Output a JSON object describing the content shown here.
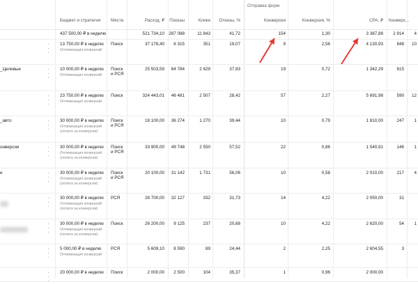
{
  "table": {
    "group_header": "Отправка форм",
    "columns": {
      "budget": "Бюджет и стратегия",
      "places": "Места",
      "spend": "Расход, ₽",
      "impressions": "Показы",
      "clicks": "Клики",
      "bounces": "Отказы, %",
      "conversions": "Конверсии",
      "conv_rate": "Конверсия, %",
      "cpa": "CPA, ₽",
      "conv_extra": "Конверс..."
    },
    "total": {
      "budget": "437 500,00 ₽ в неделю",
      "spend": "521 734,10",
      "impressions": "287 088",
      "clicks": "11 843",
      "bounces": "41,72",
      "conversions": "154",
      "conv_rate": "1,30",
      "cpa": "3 387,88",
      "conv_extra": "2 914",
      "last": "4"
    },
    "rows": [
      {
        "name": "",
        "budget": "13 750,00 ₽ в неделю",
        "strategy": "Оптимизация конверсий",
        "strategy2": "",
        "places": "Поиск",
        "places2": "",
        "spend": "37 178,40",
        "impressions": "6 315",
        "clicks": "351",
        "bounces": "19,07",
        "conversions": "9",
        "conv_rate": "2,56",
        "cpa": "4 130,93",
        "conv_extra": "848",
        "last": "10"
      },
      {
        "name": "_Целевые",
        "budget": "10 000,00 ₽ в неделю",
        "strategy": "Оптимизация конверсий",
        "strategy2": "",
        "places": "Поиск",
        "places2": "и РСЯ",
        "spend": "25 503,59",
        "impressions": "64 784",
        "clicks": "2 629",
        "bounces": "37,93",
        "conversions": "19",
        "conv_rate": "0,72",
        "cpa": "1 342,29",
        "conv_extra": "815",
        "last": ""
      },
      {
        "name": "",
        "budget": "23 750,00 ₽ в неделю",
        "strategy": "Оптимизация конверсий",
        "strategy2": "",
        "places": "Поиск",
        "places2": "",
        "spend": "324 443,01",
        "impressions": "46 481",
        "clicks": "2 507",
        "bounces": "28,42",
        "conversions": "57",
        "conv_rate": "2,27",
        "cpa": "5 691,98",
        "conv_extra": "590",
        "last": "12"
      },
      {
        "name": "_авто",
        "budget": "30 000,00 ₽ в неделю",
        "strategy": "Оптимизация конверсий",
        "strategy2": "(оплата за конверсии)",
        "places": "Поиск",
        "places2": "и РСЯ",
        "spend": "18 100,00",
        "impressions": "36 274",
        "clicks": "1 270",
        "bounces": "39,44",
        "conversions": "10",
        "conv_rate": "0,79",
        "cpa": "1 810,00",
        "conv_extra": "247",
        "last": "1"
      },
      {
        "name": "онверсии",
        "budget": "30 000,00 ₽ в неделю",
        "strategy": "Оптимизация конверсий",
        "strategy2": "(оплата за конверсии)",
        "places": "Поиск",
        "places2": "и РСЯ",
        "spend": "33 900,00",
        "impressions": "49 748",
        "clicks": "2 550",
        "bounces": "57,52",
        "conversions": "22",
        "conv_rate": "0,86",
        "cpa": "1 540,91",
        "conv_extra": "146",
        "last": "1"
      },
      {
        "name": "и",
        "budget": "30 000,00 ₽ в неделю",
        "strategy": "Оптимизация конверсий",
        "strategy2": "(оплата за конверсии)",
        "places": "Поиск",
        "places2": "и РСЯ",
        "spend": "20 100,00",
        "impressions": "31 142",
        "clicks": "1 731",
        "bounces": "56,06",
        "conversions": "10",
        "conv_rate": "0,58",
        "cpa": "2 010,00",
        "conv_extra": "217",
        "last": "4"
      },
      {
        "name": "",
        "budget": "30 000,00 ₽ в неделю",
        "strategy": "Оптимизация конверсий",
        "strategy2": "(оплата за конверсии)",
        "places": "РСЯ",
        "places2": "",
        "spend": "28 700,00",
        "impressions": "32 127",
        "clicks": "332",
        "bounces": "31,73",
        "conversions": "14",
        "conv_rate": "4,22",
        "cpa": "2 050,00",
        "conv_extra": "31",
        "last": ""
      },
      {
        "name": "",
        "budget": "30 000,00 ₽ в неделю",
        "strategy": "Оптимизация конверсий",
        "strategy2": "(оплата за конверсии)",
        "places": "Поиск",
        "places2": "",
        "spend": "26 200,00",
        "impressions": "9 125",
        "clicks": "237",
        "bounces": "20,68",
        "conversions": "10",
        "conv_rate": "4,22",
        "cpa": "2 620,00",
        "conv_extra": "54",
        "last": "1"
      },
      {
        "name": "",
        "budget": "5 000,00 ₽ в неделю",
        "strategy": "Оптимизация конверсий",
        "strategy2": "",
        "places": "РСЯ",
        "places2": "",
        "spend": "5 609,10",
        "impressions": "8 590",
        "clicks": "89",
        "bounces": "24,44",
        "conversions": "2",
        "conv_rate": "2,25",
        "cpa": "2 804,55",
        "conv_extra": "3",
        "last": ""
      },
      {
        "name": "",
        "budget": "20 000,00 ₽ в неделю",
        "strategy": "",
        "strategy2": "",
        "places": "Поиск",
        "places2": "",
        "spend": "2 000,00",
        "impressions": "2 500",
        "clicks": "104",
        "bounces": "35,37",
        "conversions": "1",
        "conv_rate": "0,96",
        "cpa": "2 000,00",
        "conv_extra": "",
        "last": ""
      }
    ],
    "row_menu_icon": "vertical-dots-icon"
  },
  "annotations": {
    "arrow_color": "#e53935"
  }
}
